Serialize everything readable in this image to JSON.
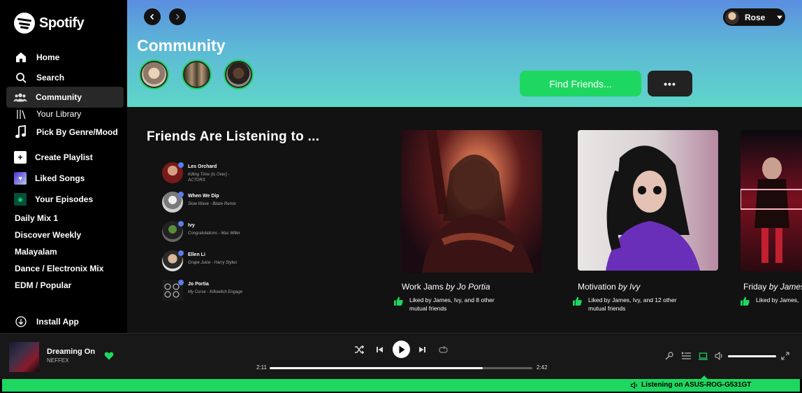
{
  "app": {
    "name": "Spotify"
  },
  "sidebar": {
    "nav": [
      {
        "label": "Home",
        "icon": "home-icon"
      },
      {
        "label": "Search",
        "icon": "search-icon"
      },
      {
        "label": "Community",
        "icon": "community-icon",
        "active": true
      },
      {
        "label": "Your Library",
        "icon": "library-icon"
      },
      {
        "label": "Pick By Genre/Mood",
        "icon": "music-note-icon"
      }
    ],
    "actions": [
      {
        "label": "Create Playlist",
        "icon": "plus-icon"
      },
      {
        "label": "Liked Songs",
        "icon": "heart-icon"
      },
      {
        "label": "Your Episodes",
        "icon": "podcast-icon"
      }
    ],
    "playlists": [
      "Daily Mix 1",
      "Discover Weekly",
      "Malayalam",
      "Dance / Electronix Mix",
      "EDM / Popular"
    ],
    "install_label": "Install App"
  },
  "header": {
    "title": "Community",
    "find_friends_label": "Find Friends...",
    "more_label": "•••",
    "user_name": "Rose"
  },
  "friends": {
    "section_title": "Friends Are Listening to ...",
    "items": [
      {
        "name": "Les Orchard",
        "song": "Killing Time (Is Over) - ACTORS"
      },
      {
        "name": "When We Dip",
        "song": "Slow Wave - Blaze Remix"
      },
      {
        "name": "Ivy",
        "song": "Congratulations - Mac Miller"
      },
      {
        "name": "Ellen Li",
        "song": "Grape Juice - Harry Styles"
      },
      {
        "name": "Jo Portia",
        "song": "My Curse - Killswitch Engage"
      }
    ]
  },
  "cards": [
    {
      "title": "Work Jams",
      "by": "by Jo Portia",
      "liked": "Liked by James, Ivy, and 8 other mutual friends"
    },
    {
      "title": "Motivation",
      "by": "by Ivy",
      "liked": "Liked by James, Ivy, and 12 other mutual friends"
    },
    {
      "title": "Friday",
      "by": "by James",
      "liked": "Liked by James,"
    }
  ],
  "player": {
    "track": "Dreaming On",
    "artist": "NEFFEX",
    "elapsed": "2:11",
    "duration": "2:42",
    "progress_fraction": 0.81,
    "volume_fraction": 1.0,
    "device_label": "Listening on ASUS-ROG-G531GT"
  },
  "colors": {
    "accent": "#1ed760",
    "bg": "#121212",
    "sidebar": "#000000"
  }
}
